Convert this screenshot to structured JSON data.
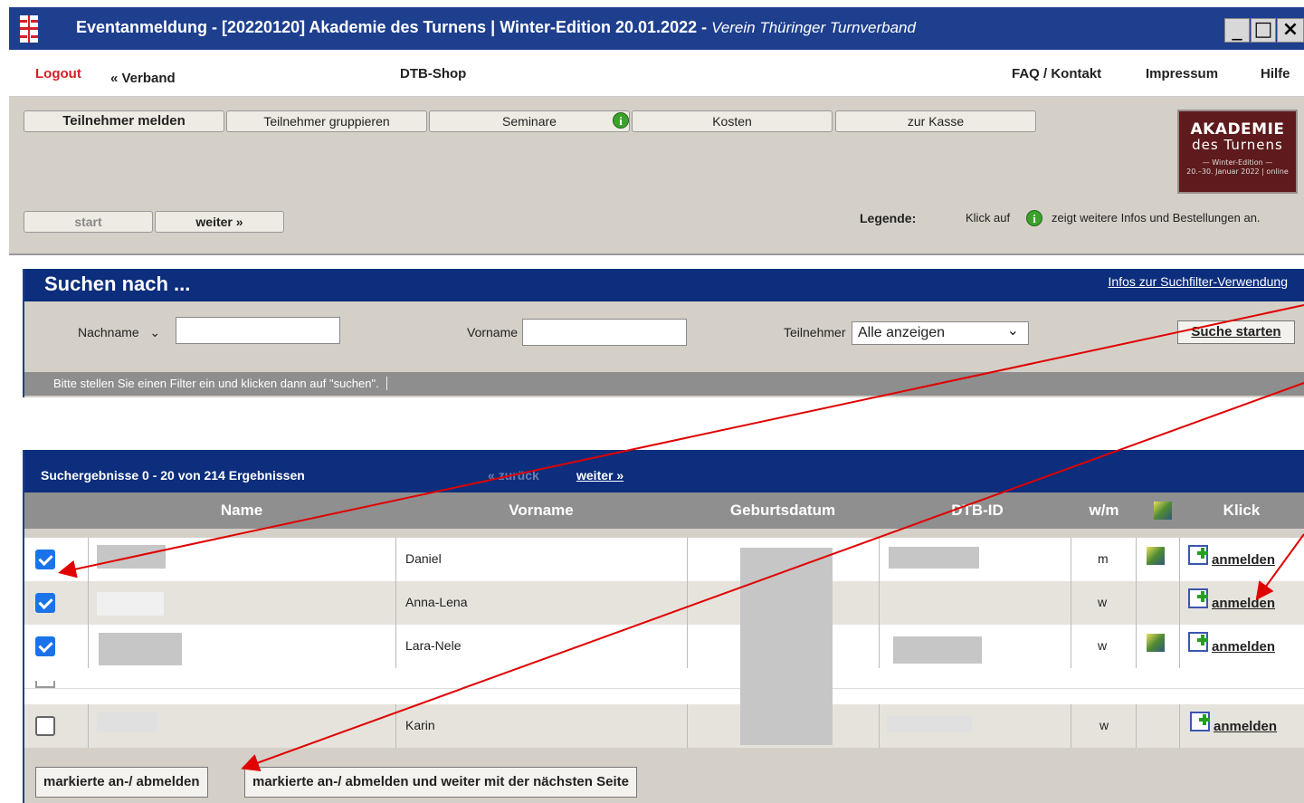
{
  "window": {
    "title": "Eventanmeldung  -  [20220120] Akademie des Turnens | Winter-Edition 20.01.2022",
    "separator": "  -  ",
    "subtitle": "Verein Thüringer Turnverband",
    "close_glyph": "×"
  },
  "menu": {
    "logout": "Logout",
    "verband": "« Verband",
    "shop": "DTB-Shop",
    "faq": "FAQ / Kontakt",
    "impressum": "Impressum",
    "hilfe": "Hilfe"
  },
  "tabs": [
    "Teilnehmer melden",
    "Teilnehmer gruppieren",
    "Seminare",
    "Kosten",
    "zur Kasse"
  ],
  "nav": {
    "start": "start",
    "weiter": "weiter »"
  },
  "legend": {
    "label": "Legende:",
    "pre": "Klick auf",
    "post": "zeigt weitere Infos und Bestellungen an.",
    "info_glyph": "i"
  },
  "logo": {
    "line1": "AKADEMIE",
    "line2": "des Turnens",
    "line3": "— Winter-Edition —",
    "line4": "20.–30. Januar 2022 | online"
  },
  "search": {
    "title": "Suchen nach ...",
    "help_link": "Infos zur Suchfilter-Verwendung",
    "nachname_label": "Nachname",
    "vorname_label": "Vorname",
    "teilnehmer_label": "Teilnehmer",
    "teilnehmer_value": "Alle anzeigen",
    "submit": "Suche starten",
    "hint": "Bitte stellen Sie einen Filter ein und klicken dann auf \"suchen\"."
  },
  "results": {
    "summary": "Suchergebnisse 0 - 20 von 214 Ergebnissen",
    "prev": "« zurück",
    "next": "weiter »",
    "columns": [
      "Name",
      "Vorname",
      "Geburtsdatum",
      "DTB-ID",
      "w/m",
      "Klick"
    ],
    "rows": [
      {
        "vorname": "Daniel",
        "wm": "m",
        "checked": true,
        "action": "anmelden"
      },
      {
        "vorname": "Anna-Lena",
        "wm": "w",
        "checked": true,
        "action": "anmelden"
      },
      {
        "vorname": "Lara-Nele",
        "wm": "w",
        "checked": true,
        "action": "anmelden"
      },
      {
        "vorname": "Karin",
        "wm": "w",
        "checked": false,
        "action": "anmelden"
      }
    ],
    "footer_btn1": "markierte an-/ abmelden",
    "footer_btn2": "markierte an-/ abmelden und weiter mit der nächsten Seite"
  },
  "colors": {
    "titlebar": "#1e3f8e",
    "accent": "#0d2e7c",
    "logout": "#d52027",
    "arrow": "#e00000",
    "logo_bg": "#5e1a1c"
  }
}
